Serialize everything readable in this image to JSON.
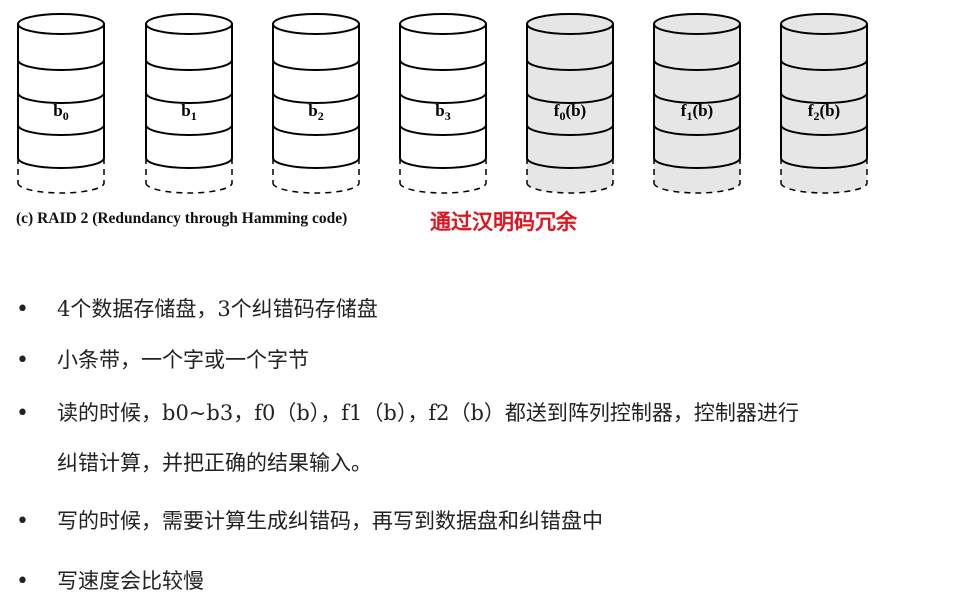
{
  "disks": [
    {
      "base": "b",
      "sub": "0",
      "suffix": "",
      "shade": "#ffffff"
    },
    {
      "base": "b",
      "sub": "1",
      "suffix": "",
      "shade": "#ffffff"
    },
    {
      "base": "b",
      "sub": "2",
      "suffix": "",
      "shade": "#ffffff"
    },
    {
      "base": "b",
      "sub": "3",
      "suffix": "",
      "shade": "#ffffff"
    },
    {
      "base": "f",
      "sub": "0",
      "suffix": "(b)",
      "shade": "#e6e6e6"
    },
    {
      "base": "f",
      "sub": "1",
      "suffix": "(b)",
      "shade": "#e6e6e6"
    },
    {
      "base": "f",
      "sub": "2",
      "suffix": "(b)",
      "shade": "#e6e6e6"
    }
  ],
  "caption": "(c) RAID 2 (Redundancy through Hamming code)",
  "caption_note": "通过汉明码冗余",
  "bullets": [
    {
      "symbol": "•",
      "text": "4个数据存储盘，3个纠错码存储盘"
    },
    {
      "symbol": "•",
      "text": "小条带，一个字或一个字节"
    },
    {
      "symbol": "•",
      "text": "读的时候，b0~b3，f0（b），f1（b），f2（b）都送到阵列控制器，控制器进行\n纠错计算，并把正确的结果输入。"
    },
    {
      "symbol": "•",
      "text": "写的时候，需要计算生成纠错码，再写到数据盘和纠错盘中"
    },
    {
      "symbol": "•",
      "text": "写速度会比较慢"
    }
  ]
}
